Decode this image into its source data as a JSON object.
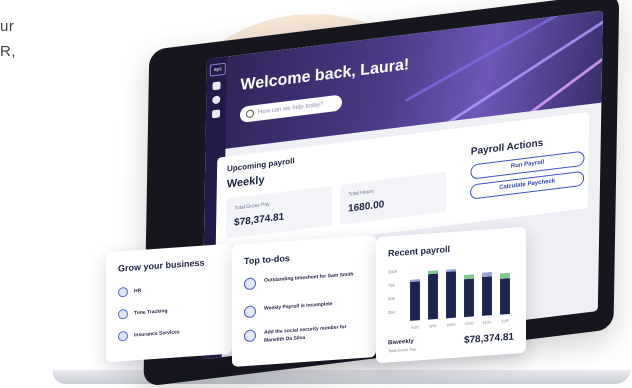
{
  "edge_text": [
    "ur",
    "R,"
  ],
  "app": {
    "logo": "ays",
    "welcome": "Welcome back, Laura!",
    "search_placeholder": "How can we help today?"
  },
  "upcoming": {
    "label": "Upcoming payroll",
    "frequency": "Weekly",
    "stats": [
      {
        "label": "Total Gross Pay",
        "value": "$78,374.81"
      },
      {
        "label": "Total Hours",
        "value": "1680.00"
      }
    ]
  },
  "payroll_actions": {
    "title": "Payroll Actions",
    "buttons": [
      "Run Payroll",
      "Calculate Paycheck"
    ]
  },
  "grow": {
    "title": "Grow your business",
    "items": [
      "HR",
      "Time Tracking",
      "Insurance Services"
    ]
  },
  "todos": {
    "title": "Top to-dos",
    "items": [
      "Outstanding timesheet for Sam Smith",
      "Weekly Payroll is incomplete",
      "Add the social security number for Manelith Da Silva"
    ]
  },
  "recent_payroll": {
    "title": "Recent payroll",
    "frequency": "Biweekly",
    "sub_label": "Total Gross Pay",
    "amount": "$78,374.81"
  },
  "colors": {
    "bar_primary": "#1c2450",
    "bar_accent": "#7ec98f",
    "bar_top": "#9aa6d8",
    "brand": "#3d55c8"
  },
  "chart_data": {
    "type": "bar",
    "title": "Recent payroll",
    "y_tick_labels": [
      "100K",
      "75K",
      "50K",
      "25K"
    ],
    "categories": [
      "6/16",
      "6/30",
      "10/02",
      "10/20",
      "11/20",
      "12/8"
    ],
    "ylim": [
      0,
      100
    ],
    "series": [
      {
        "values": [
          72,
          84,
          86,
          70,
          72,
          66
        ]
      },
      {
        "values": [
          4,
          6,
          4,
          8,
          8,
          10
        ]
      }
    ]
  }
}
